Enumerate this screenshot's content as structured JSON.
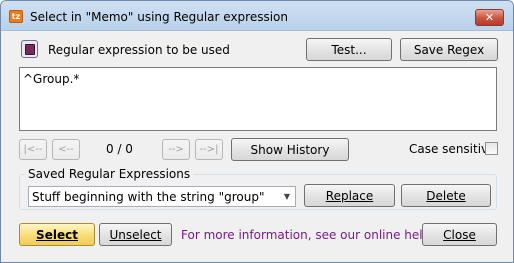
{
  "window": {
    "title": "Select in \"Memo\" using Regular expression",
    "app_icon_text": "tz",
    "close_glyph": "✕"
  },
  "regex": {
    "label": "Regular expression to be used",
    "value": "^Group.*",
    "test_label": "Test...",
    "save_label": "Save Regex"
  },
  "navigation": {
    "first": "|<--",
    "prev": "<--",
    "counter": "0 / 0",
    "next": "-->",
    "last": "-->|",
    "show_history": "Show History"
  },
  "case_sensitive": {
    "label": "Case sensitive",
    "checked": false
  },
  "saved": {
    "group_title": "Saved Regular Expressions",
    "selected": "Stuff beginning with the string \"group\"",
    "replace_label": "Replace",
    "delete_label": "Delete"
  },
  "footer": {
    "select_label": "Select",
    "unselect_label": "Unselect",
    "info_text": "For more information, see our online help ...",
    "close_label": "Close"
  },
  "colors": {
    "link": "#7a1a8a",
    "primary_button": "#f8dc78",
    "close_button": "#c8543f"
  }
}
